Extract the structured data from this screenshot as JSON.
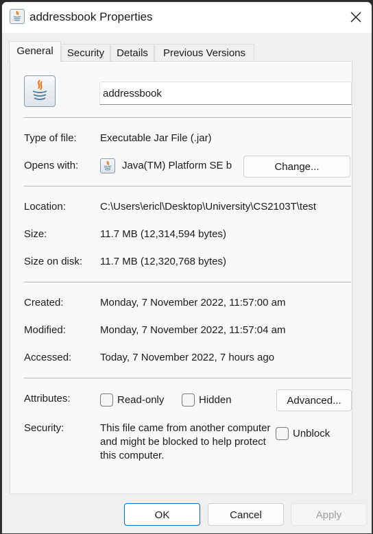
{
  "window": {
    "title": "addressbook Properties",
    "close_icon": "close-icon",
    "app_icon": "java-icon"
  },
  "tabs": [
    {
      "label": "General",
      "active": true
    },
    {
      "label": "Security",
      "active": false
    },
    {
      "label": "Details",
      "active": false
    },
    {
      "label": "Previous Versions",
      "active": false
    }
  ],
  "general": {
    "file_name": "addressbook",
    "type_of_file": {
      "label": "Type of file:",
      "value": "Executable Jar File (.jar)"
    },
    "opens_with": {
      "label": "Opens with:",
      "value": "Java(TM) Platform SE b",
      "change_button": "Change..."
    },
    "location": {
      "label": "Location:",
      "value": "C:\\Users\\ericl\\Desktop\\University\\CS2103T\\test"
    },
    "size": {
      "label": "Size:",
      "value": "11.7 MB (12,314,594 bytes)"
    },
    "size_on_disk": {
      "label": "Size on disk:",
      "value": "11.7 MB (12,320,768 bytes)"
    },
    "created": {
      "label": "Created:",
      "value": "Monday, 7 November 2022, 11:57:00 am"
    },
    "modified": {
      "label": "Modified:",
      "value": "Monday, 7 November 2022, 11:57:04 am"
    },
    "accessed": {
      "label": "Accessed:",
      "value": "Today, 7 November 2022, 7 hours ago"
    },
    "attributes": {
      "label": "Attributes:",
      "read_only": {
        "label": "Read-only",
        "checked": false
      },
      "hidden": {
        "label": "Hidden",
        "checked": false
      },
      "advanced_button": "Advanced..."
    },
    "security": {
      "label": "Security:",
      "message": "This file came from another computer and might be blocked to help protect this computer.",
      "unblock": {
        "label": "Unblock",
        "checked": false
      }
    }
  },
  "footer": {
    "ok": "OK",
    "cancel": "Cancel",
    "apply": "Apply",
    "apply_enabled": false
  },
  "colors": {
    "accent": "#0067c0",
    "disabled_text": "#9d9d9d"
  }
}
